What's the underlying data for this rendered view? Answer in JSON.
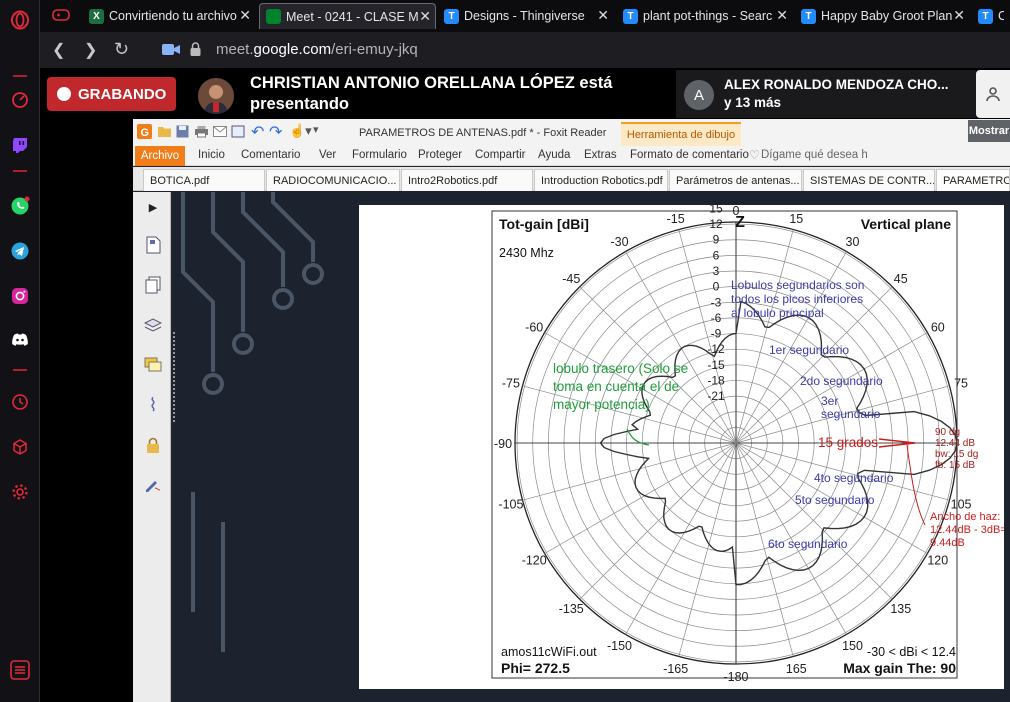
{
  "browser": {
    "tabs": [
      {
        "title": "Convirtiendo tu archivo",
        "favicon_color": "#1d6f42",
        "favicon_letter": "X",
        "active": false
      },
      {
        "title": "Meet - 0241 - CLASE M",
        "favicon_color": "#00832d",
        "favicon_letter": "",
        "active": true
      },
      {
        "title": "Designs - Thingiverse",
        "favicon_color": "#248bfb",
        "favicon_letter": "T",
        "active": false
      },
      {
        "title": "plant pot-things - Searc",
        "favicon_color": "#248bfb",
        "favicon_letter": "T",
        "active": false
      },
      {
        "title": "Happy Baby Groot Plan",
        "favicon_color": "#248bfb",
        "favicon_letter": "T",
        "active": false
      },
      {
        "title": "Ca",
        "favicon_color": "#248bfb",
        "favicon_letter": "T",
        "active": false
      }
    ],
    "url_prefix": "meet.",
    "url_domain": "google.com",
    "url_path": "/eri-emuy-jkq"
  },
  "meet": {
    "recording_label": "GRABANDO",
    "presenter_line1": "CHRISTIAN ANTONIO ORELLANA LÓPEZ está",
    "presenter_line2": "presentando",
    "participant_initial": "A",
    "participant_name": "ALEX RONALDO MENDOZA CHO...",
    "participant_more": "y 13 más"
  },
  "foxit": {
    "title": "PARAMETROS DE ANTENAS.pdf * - Foxit Reader",
    "tool_tab": "Herramienta de dibujo",
    "mostrar": "Mostrar",
    "menu": [
      "Archivo",
      "Inicio",
      "Comentario",
      "Ver",
      "Formulario",
      "Proteger",
      "Compartir",
      "Ayuda",
      "Extras",
      "Formato de comentario"
    ],
    "tell_me": "Dígame qué desea h",
    "doc_tabs": [
      "BOTICA.pdf",
      "RADIOCOMUNICACIO...",
      "Intro2Robotics.pdf",
      "Introduction Robotics.pdf",
      "Parámetros de antenas...",
      "SISTEMAS DE CONTR...",
      "PARAMETROS"
    ]
  },
  "polar": {
    "title": "Tot-gain [dBi]",
    "plane": "Vertical plane",
    "freq": "2430 Mhz",
    "zenith": "Z",
    "file": "amos11cWiFi.out",
    "phi": "Phi= 272.5",
    "range": "-30 < dBi < 12.4",
    "max_gain": "Max gain The: 90",
    "angles": [
      {
        "label": "0",
        "deg": 0
      },
      {
        "label": "15",
        "deg": 15
      },
      {
        "label": "30",
        "deg": 30
      },
      {
        "label": "45",
        "deg": 45
      },
      {
        "label": "60",
        "deg": 60
      },
      {
        "label": "75",
        "deg": 75
      },
      {
        "label": "105",
        "deg": 105
      },
      {
        "label": "120",
        "deg": 120
      },
      {
        "label": "135",
        "deg": 135
      },
      {
        "label": "150",
        "deg": 150
      },
      {
        "label": "165",
        "deg": 165
      },
      {
        "label": "-180",
        "deg": 180
      },
      {
        "label": "-165",
        "deg": -165
      },
      {
        "label": "-150",
        "deg": -150
      },
      {
        "label": "-135",
        "deg": -135
      },
      {
        "label": "-120",
        "deg": -120
      },
      {
        "label": "-105",
        "deg": -105
      },
      {
        "label": "-90",
        "deg": -90
      },
      {
        "label": "-75",
        "deg": -75
      },
      {
        "label": "-60",
        "deg": -60
      },
      {
        "label": "-45",
        "deg": -45
      },
      {
        "label": "-30",
        "deg": -30
      },
      {
        "label": "-15",
        "deg": -15
      }
    ],
    "radial_labels": [
      "15",
      "12",
      "9",
      "6",
      "3",
      "0",
      "-3",
      "-6",
      "-9",
      "-12",
      "-15",
      "-18",
      "-21"
    ],
    "radial_values": [
      15,
      12,
      9,
      6,
      3,
      0,
      -3,
      -6,
      -9,
      -12,
      -15,
      -18,
      -21
    ],
    "beam_info": [
      "90 dg",
      "12.44 dB",
      "bw: 15 dg",
      "fb: 15 dB"
    ],
    "annotations": {
      "secondary_def": [
        "Lobulos segundarios son",
        "todos los picos inferiores",
        "al lobulo principal"
      ],
      "back_lobe": [
        "lobulo trasero (Solo se",
        "toma en cuenta el de",
        "mayor potencia)"
      ],
      "lobes": [
        "1er segundario",
        "2do segundario",
        "3er",
        "segundario",
        "4to segundario",
        "5to segundario",
        "6to segundario"
      ],
      "grados": "15 grados",
      "beamwidth": [
        "Ancho de haz:",
        "12.44dB - 3dB=",
        "9.44dB"
      ]
    },
    "colors": {
      "grid": "#8a8a8a",
      "pattern": "#333333",
      "blue_note": "#3b3ba8",
      "green_note": "#1f9e3a",
      "red_note": "#cc1e1e"
    }
  }
}
